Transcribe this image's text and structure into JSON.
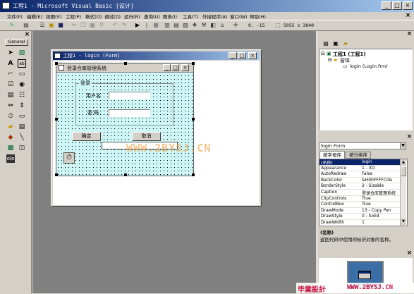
{
  "window": {
    "title": "工程1 - Microsoft Visual Basic [设计]",
    "min": "_",
    "max": "□",
    "close": "×"
  },
  "menu": [
    "文件(F)",
    "编辑(E)",
    "视图(V)",
    "工程(P)",
    "格式(O)",
    "调试(D)",
    "运行(R)",
    "查询(U)",
    "图表(I)",
    "工具(T)",
    "外接程序(A)",
    "窗口(W)",
    "帮助(H)"
  ],
  "toolbar": {
    "coords": "0, -15",
    "size": "5055 x 3840"
  },
  "toolbox": {
    "tab_label": "General"
  },
  "form_window": {
    "title": "工程1 - login (Form)"
  },
  "designed_form": {
    "caption": "登录仓库管理系统",
    "frame_caption": "登录",
    "username_label": "用户名",
    "password_label": "密 码",
    "ok_button": "确定",
    "cancel_button": "取消"
  },
  "project_explorer": {
    "root": "工程1 (工程1)",
    "folder": "窗体",
    "item": "login (Login.frm)"
  },
  "properties": {
    "object": "login Form",
    "tabs": [
      "按字母序",
      "按分类序"
    ],
    "rows": [
      {
        "k": "(名称)",
        "v": "login"
      },
      {
        "k": "Appearance",
        "v": "1 - 3D"
      },
      {
        "k": "AutoRedraw",
        "v": "False"
      },
      {
        "k": "BackColor",
        "v": "&H00FFFFC0&"
      },
      {
        "k": "BorderStyle",
        "v": "2 - Sizable"
      },
      {
        "k": "Caption",
        "v": "登录仓库管理系统"
      },
      {
        "k": "ClipControls",
        "v": "True"
      },
      {
        "k": "ControlBox",
        "v": "True"
      },
      {
        "k": "DrawMode",
        "v": "13 - Copy Pen"
      },
      {
        "k": "DrawStyle",
        "v": "0 - Solid"
      },
      {
        "k": "DrawWidth",
        "v": "1"
      }
    ],
    "desc_title": "(名称)",
    "desc_text": "返回代码中使用的标识对象的名称。",
    "selected_color": "#0a246a"
  },
  "watermark": {
    "center": "WWW.2BYSJ.CN",
    "corner_left": "毕業設計",
    "corner_right": "WWW.2BYSJ.CN"
  }
}
